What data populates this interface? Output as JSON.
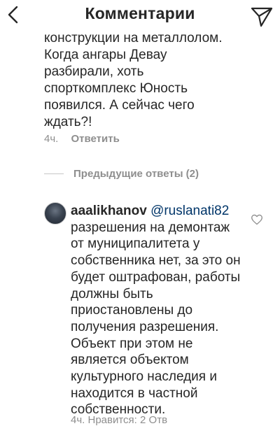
{
  "header": {
    "title": "Комментарии",
    "back_icon": "chevron-left-icon",
    "send_icon": "paper-plane-icon"
  },
  "comment": {
    "text": "конструкции на металлолом.\nКогда ангары Девау\nразбирали, хоть\nспорткомплекс Юность\nпоявился. А сейчас чего\nждать?!",
    "time": "4ч.",
    "reply_label": "Ответить"
  },
  "previous_replies": {
    "label": "Предыдущие ответы (2)"
  },
  "reply": {
    "username": "aaalikhanov",
    "mention": "@ruslanati82",
    "text": "разрешения на демонтаж от муниципалитета у собственника нет, за это он будет оштрафован, работы должны быть приостановлены до получения разрешения. Объект при этом не является объектом культурного наследия и находится в частной собственности.",
    "meta_partial": "4ч.   Нравится: 2   Отв"
  },
  "colors": {
    "text": "#262626",
    "secondary": "#8e8e8e",
    "link": "#003569"
  }
}
